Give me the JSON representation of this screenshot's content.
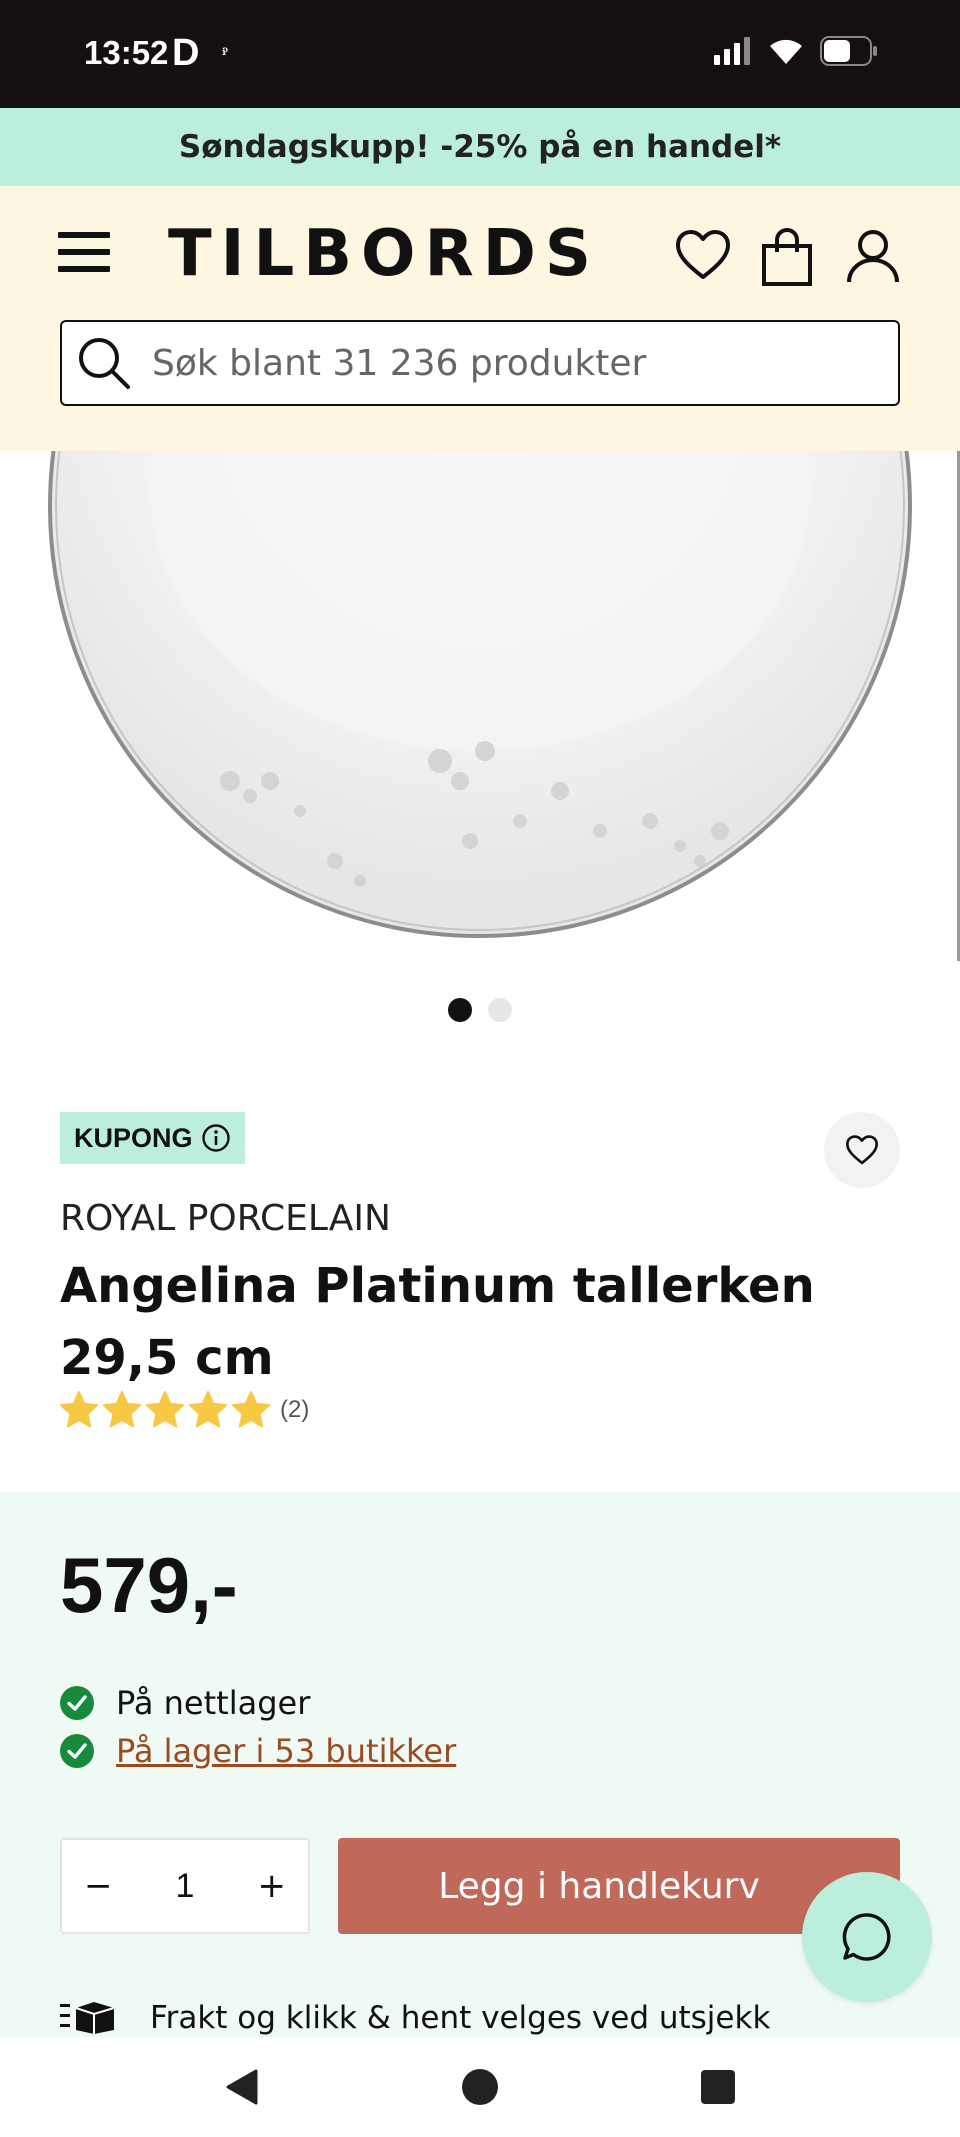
{
  "status_bar": {
    "time": "13:52",
    "app_indicator": "D",
    "extra_indicator": "ꭾ"
  },
  "promo": {
    "text": "Søndagskupp! -25% på en handel*"
  },
  "header": {
    "logo": "TILBORDS",
    "menu_icon": "hamburger-menu-icon",
    "icons": [
      "heart-icon",
      "shopping-bag-icon",
      "user-icon"
    ]
  },
  "search": {
    "placeholder": "Søk blant 31 236 produkter",
    "value": ""
  },
  "gallery": {
    "image_count": 2,
    "active_index": 0
  },
  "product": {
    "badge": "KUPONG",
    "brand": "ROYAL PORCELAIN",
    "title": "Angelina Platinum tallerken 29,5 cm",
    "rating": 5,
    "rating_count": "(2)"
  },
  "buy": {
    "price": "579,-",
    "stock_online": "På nettlager",
    "stock_stores": "På lager i 53 butikker",
    "quantity": "1",
    "minus": "−",
    "plus": "+",
    "add_to_cart": "Legg i handlekurv",
    "shipping": "Frakt og klikk & hent velges ved utsjekk"
  },
  "colors": {
    "promo_bg": "#bbeedb",
    "header_bg": "#fdf6e1",
    "buybox_bg": "#effaf5",
    "cart_button": "#c0695b",
    "stock_green": "#188a3c",
    "star": "#f7c844"
  }
}
